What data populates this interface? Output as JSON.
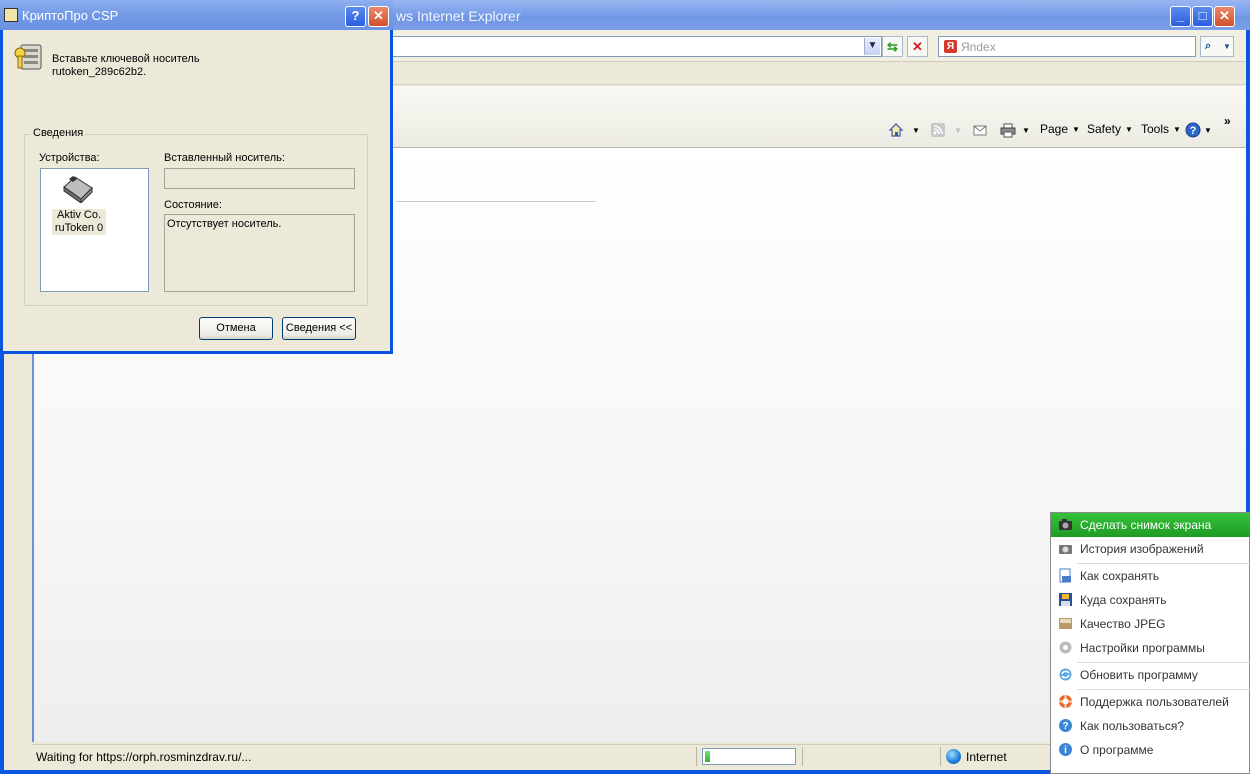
{
  "ie": {
    "title": "ws Internet Explorer",
    "search_placeholder": "Яndex",
    "yandex_logo": "Я",
    "toolbar": {
      "page": "Page",
      "safety": "Safety",
      "tools": "Tools",
      "more": "»"
    },
    "status_text": "Waiting for https://orph.rosminzdrav.ru/...",
    "progress": 0.06,
    "zone": "Internet"
  },
  "dialog": {
    "title": "КриптоПро CSP",
    "message_line1": "Вставьте ключевой носитель",
    "message_line2": "rutoken_289c62b2.",
    "group_label": "Сведения",
    "devices_label": "Устройства:",
    "device_name": "Aktiv Co. ruToken 0",
    "inserted_label": "Вставленный носитель:",
    "inserted_value": "",
    "state_label": "Состояние:",
    "state_value": "Отсутствует носитель.",
    "cancel_button": "Отмена",
    "details_button": "Сведения <<"
  },
  "tray_menu": {
    "items": [
      {
        "label": "Сделать снимок экрана",
        "icon": "camera-icon",
        "active": true
      },
      {
        "label": "История изображений",
        "icon": "history-icon"
      },
      {
        "label": "Как сохранять",
        "icon": "save-as-icon"
      },
      {
        "label": "Куда сохранять",
        "icon": "floppy-icon"
      },
      {
        "label": "Качество JPEG",
        "icon": "jpeg-icon"
      },
      {
        "label": "Настройки программы",
        "icon": "gear-icon"
      },
      {
        "label": "Обновить программу",
        "icon": "update-icon"
      },
      {
        "label": "Поддержка пользователей",
        "icon": "lifebuoy-icon"
      },
      {
        "label": "Как пользоваться?",
        "icon": "help-icon"
      },
      {
        "label": "О программе",
        "icon": "info-icon"
      }
    ]
  },
  "colors": {
    "xp_blue": "#0a58e0",
    "menu_active": "#1f9b25",
    "dialog_face": "#ece9d8"
  }
}
